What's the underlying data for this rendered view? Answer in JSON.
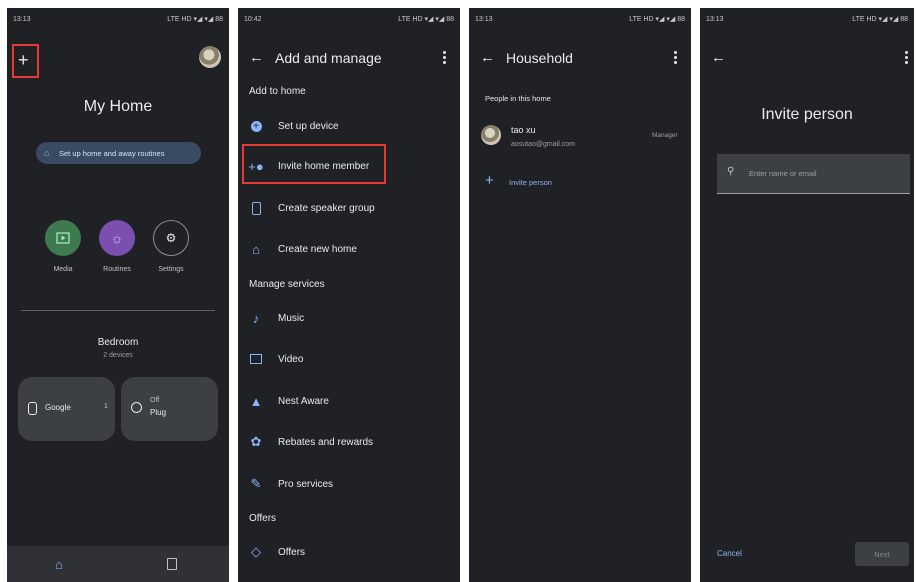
{
  "panel1": {
    "status_time": "13:13",
    "status_right": "LTE HD ▾◢ ▾◢ 88",
    "title": "My Home",
    "routine_chip": "Set up home and away routines",
    "shortcuts": [
      {
        "label": "Media",
        "color": "#3d7a4f"
      },
      {
        "label": "Routines",
        "color": "#7b4fb0"
      },
      {
        "label": "Settings",
        "color": "#202124"
      }
    ],
    "room_name": "Bedroom",
    "room_devices": "2 devices",
    "device_google_label": "Google",
    "device_google_count": "1",
    "device_plug_state": "Off",
    "device_plug_label": "Plug"
  },
  "panel2": {
    "status_time": "10:42",
    "status_right": "LTE HD ▾◢ ▾◢ 88",
    "title": "Add and manage",
    "section_add": "Add to home",
    "item_setup": "Set up device",
    "item_invite": "Invite home member",
    "item_speaker": "Create speaker group",
    "item_newhome": "Create new home",
    "section_manage": "Manage services",
    "item_music": "Music",
    "item_video": "Video",
    "item_nest": "Nest Aware",
    "item_rebates": "Rebates and rewards",
    "item_pro": "Pro services",
    "section_offers": "Offers",
    "item_offers": "Offers"
  },
  "panel3": {
    "status_time": "13:13",
    "status_right": "LTE HD ▾◢ ▾◢ 88",
    "title": "Household",
    "people_label": "People in this home",
    "member_name": "tao xu",
    "member_email": "aosutao@gmail.com",
    "member_role": "Manager",
    "invite_label": "Invite person"
  },
  "panel4": {
    "status_time": "13:13",
    "status_right": "LTE HD ▾◢ ▾◢ 88",
    "title": "Invite person",
    "search_placeholder": "Enter name or email",
    "cancel_label": "Cancel",
    "next_label": "Next"
  },
  "colors": {
    "background": "#202124",
    "accent": "#8ab4f8",
    "highlight": "#e53935"
  }
}
